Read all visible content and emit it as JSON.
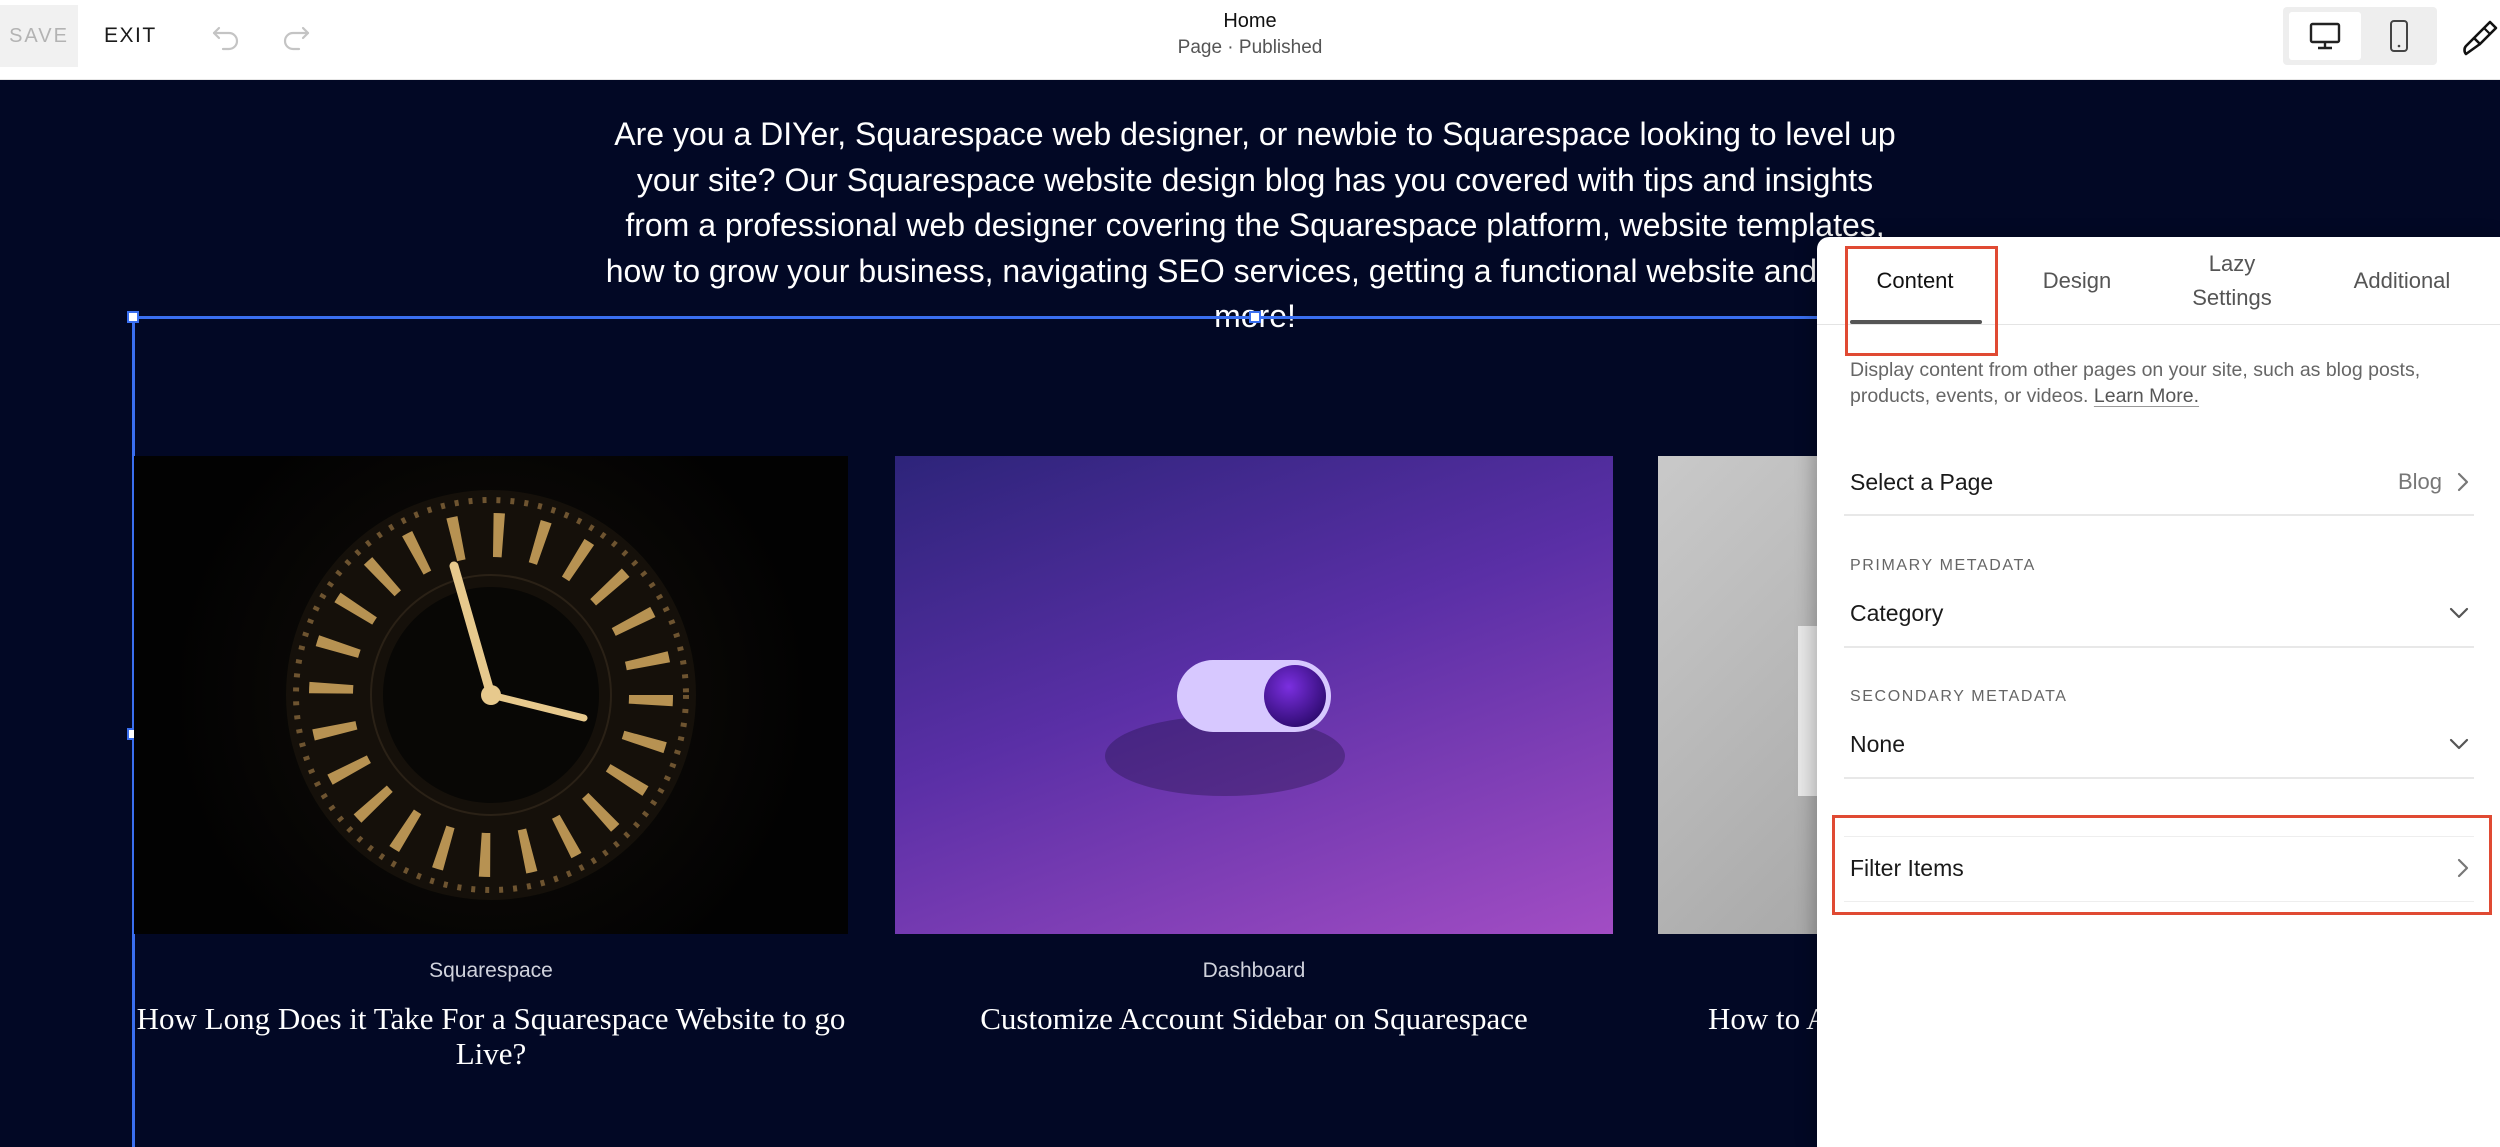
{
  "topbar": {
    "save_label": "SAVE",
    "exit_label": "EXIT",
    "page_title": "Home",
    "page_subtitle": "Page · Published"
  },
  "intro_text": "Are you a DIYer, Squarespace web designer, or newbie to Squarespace looking to level up your site? Our Squarespace website design blog has you covered with tips and insights from a professional web designer covering the Squarespace platform, website templates, how to grow your business, navigating SEO services, getting a functional website and much more!",
  "cards": [
    {
      "category": "Squarespace",
      "title": "How Long Does it Take For a Squarespace Website to go Live?"
    },
    {
      "category": "Dashboard",
      "title": "Customize Account Sidebar on Squarespace"
    },
    {
      "category": "",
      "title": "How to A"
    }
  ],
  "panel": {
    "tabs": {
      "content": "Content",
      "design": "Design",
      "lazy_line1": "Lazy",
      "lazy_line2": "Settings",
      "additional": "Additional"
    },
    "description": "Display content from other pages on your site, such as blog posts, products, events, or videos.",
    "learn_more": "Learn More.",
    "select_page_label": "Select a Page",
    "select_page_value": "Blog",
    "primary_metadata_label": "PRIMARY METADATA",
    "primary_metadata_value": "Category",
    "secondary_metadata_label": "SECONDARY METADATA",
    "secondary_metadata_value": "None",
    "filter_items_label": "Filter Items"
  },
  "colors": {
    "canvas_bg": "#020825",
    "selection_blue": "#3a6ff0",
    "highlight_red": "#e04a33"
  }
}
